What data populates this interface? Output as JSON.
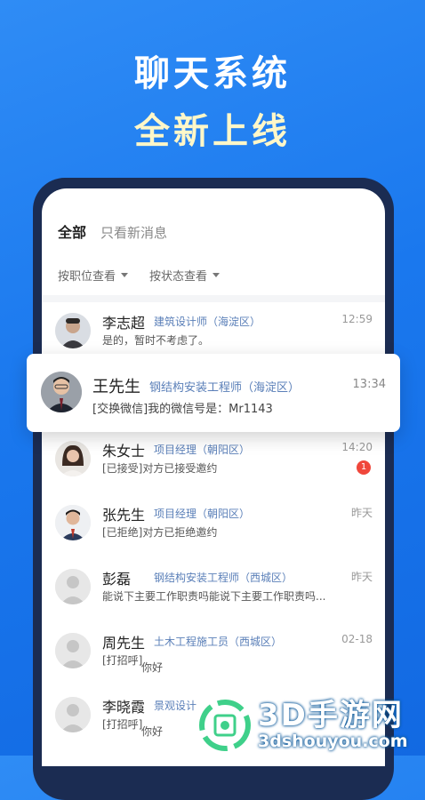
{
  "hero": {
    "line1": "聊天系统",
    "line2": "全新上线"
  },
  "tabs": {
    "all": "全部",
    "new_only": "只看新消息"
  },
  "filters": {
    "by_position": "按职位查看",
    "by_status": "按状态查看"
  },
  "highlight": {
    "name": "王先生",
    "job": "钢结构安装工程师（海淀区）",
    "time": "13:34",
    "message": "[交换微信]我的微信号是：Mr1143"
  },
  "conversations": [
    {
      "name": "李志超",
      "job": "建筑设计师（海淀区）",
      "time": "12:59",
      "message": "是的，暂时不考虑了。"
    },
    {
      "name": "朱女士",
      "job": "项目经理（朝阳区）",
      "time": "14:20",
      "message": "[已接受]对方已接受邀约",
      "badge": "1"
    },
    {
      "name": "张先生",
      "job": "项目经理（朝阳区）",
      "time": "昨天",
      "message": "[已拒绝]对方已拒绝邀约"
    },
    {
      "name": "彭磊",
      "job": "钢结构安装工程师（西城区）",
      "time": "昨天",
      "message": "能说下主要工作职责吗能说下主要工作职责吗..."
    },
    {
      "name": "周先生",
      "job": "土木工程施工员（西城区）",
      "time": "02-18",
      "message_tag": "[打招呼]",
      "message": "你好"
    },
    {
      "name": "李晓霞",
      "job": "景观设计",
      "time": "",
      "message_tag": "[打招呼]",
      "message": "你好"
    }
  ],
  "watermark": {
    "title": "3D手游网",
    "url": "3dshouyou.com"
  },
  "colors": {
    "background": "#1a78ee",
    "accent_job": "#5a7fb8",
    "badge": "#f0473b",
    "hero_line2": "#fff7c8"
  }
}
